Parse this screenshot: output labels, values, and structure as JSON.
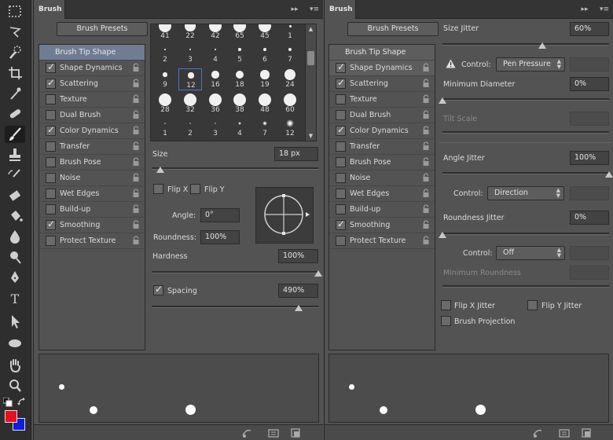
{
  "toolbar": {
    "tools": [
      {
        "name": "marquee-tool",
        "icon": "rect-marquee-icon",
        "active": false
      },
      {
        "name": "lasso-tool",
        "icon": "lasso-icon",
        "active": false
      },
      {
        "name": "quick-selection-tool",
        "icon": "quick-selection-icon",
        "active": false
      },
      {
        "name": "crop-tool",
        "icon": "crop-icon",
        "active": false
      },
      {
        "name": "eyedropper-tool",
        "icon": "eyedropper-icon",
        "active": false
      },
      {
        "name": "healing-tool",
        "icon": "bandage-icon",
        "active": false
      },
      {
        "name": "brush-tool",
        "icon": "brush-icon",
        "active": true
      },
      {
        "name": "stamp-tool",
        "icon": "stamp-icon",
        "active": false
      },
      {
        "name": "history-brush-tool",
        "icon": "history-brush-icon",
        "active": false
      },
      {
        "name": "eraser-tool",
        "icon": "eraser-icon",
        "active": false
      },
      {
        "name": "paint-bucket-tool",
        "icon": "bucket-icon",
        "active": false
      },
      {
        "name": "blur-tool",
        "icon": "drop-icon",
        "active": false
      },
      {
        "name": "dodge-tool",
        "icon": "dodge-icon",
        "active": false
      },
      {
        "name": "pen-tool",
        "icon": "pen-icon",
        "active": false
      },
      {
        "name": "type-tool",
        "icon": "type-icon",
        "glyph": "T",
        "active": false
      },
      {
        "name": "path-selection-tool",
        "icon": "arrow-icon",
        "active": false
      },
      {
        "name": "ellipse-tool",
        "icon": "ellipse-icon",
        "active": false
      },
      {
        "name": "hand-tool",
        "icon": "hand-icon",
        "active": false
      },
      {
        "name": "zoom-tool",
        "icon": "zoom-icon",
        "active": false
      }
    ],
    "foreground_color": "#e8101d",
    "background_color": "#0d1fd8"
  },
  "left_panel": {
    "tab": "Brush",
    "presets_button": "Brush Presets",
    "list": [
      {
        "label": "Brush Tip Shape",
        "header": true,
        "checked": false,
        "selected": true,
        "locked": false
      },
      {
        "label": "Shape Dynamics",
        "checked": true,
        "selected": false,
        "locked": true
      },
      {
        "label": "Scattering",
        "checked": true,
        "selected": false,
        "locked": true
      },
      {
        "label": "Texture",
        "checked": false,
        "selected": false,
        "locked": true
      },
      {
        "label": "Dual Brush",
        "checked": false,
        "selected": false,
        "locked": true
      },
      {
        "label": "Color Dynamics",
        "checked": true,
        "selected": false,
        "locked": true
      },
      {
        "label": "Transfer",
        "checked": false,
        "selected": false,
        "locked": true
      },
      {
        "label": "Brush Pose",
        "checked": false,
        "selected": false,
        "locked": true
      },
      {
        "label": "Noise",
        "checked": false,
        "selected": false,
        "locked": true
      },
      {
        "label": "Wet Edges",
        "checked": false,
        "selected": false,
        "locked": true
      },
      {
        "label": "Build-up",
        "checked": false,
        "selected": false,
        "locked": true
      },
      {
        "label": "Smoothing",
        "checked": true,
        "selected": false,
        "locked": true
      },
      {
        "label": "Protect Texture",
        "checked": false,
        "selected": false,
        "locked": true
      }
    ],
    "tips": [
      [
        "41",
        "22",
        "42",
        "65",
        "45",
        "1"
      ],
      [
        "2",
        "3",
        "4",
        "5",
        "6",
        "7"
      ],
      [
        "9",
        "12",
        "16",
        "18",
        "19",
        "24"
      ],
      [
        "28",
        "32",
        "36",
        "38",
        "48",
        "60"
      ],
      [
        "1",
        "2",
        "3",
        "4",
        "7",
        "12"
      ]
    ],
    "selected_tip": "12",
    "size_label": "Size",
    "size_value": "18 px",
    "size_slider": 0.05,
    "flip_x_label": "Flip X",
    "flip_y_label": "Flip Y",
    "flip_x": false,
    "flip_y": false,
    "angle_label": "Angle:",
    "angle_value": "0°",
    "roundness_label": "Roundness:",
    "roundness_value": "100%",
    "hardness_label": "Hardness",
    "hardness_value": "100%",
    "hardness_slider": 1.0,
    "spacing_label": "Spacing",
    "spacing_checked": true,
    "spacing_value": "490%",
    "spacing_slider": 0.88
  },
  "right_panel": {
    "tab": "Brush",
    "presets_button": "Brush Presets",
    "list": [
      {
        "label": "Brush Tip Shape",
        "header": true,
        "checked": false,
        "selected": false,
        "locked": false
      },
      {
        "label": "Shape Dynamics",
        "checked": true,
        "selected": true,
        "locked": true
      },
      {
        "label": "Scattering",
        "checked": true,
        "selected": false,
        "locked": true
      },
      {
        "label": "Texture",
        "checked": false,
        "selected": false,
        "locked": true
      },
      {
        "label": "Dual Brush",
        "checked": false,
        "selected": false,
        "locked": true
      },
      {
        "label": "Color Dynamics",
        "checked": true,
        "selected": false,
        "locked": true
      },
      {
        "label": "Transfer",
        "checked": false,
        "selected": false,
        "locked": true
      },
      {
        "label": "Brush Pose",
        "checked": false,
        "selected": false,
        "locked": true
      },
      {
        "label": "Noise",
        "checked": false,
        "selected": false,
        "locked": true
      },
      {
        "label": "Wet Edges",
        "checked": false,
        "selected": false,
        "locked": true
      },
      {
        "label": "Build-up",
        "checked": false,
        "selected": false,
        "locked": true
      },
      {
        "label": "Smoothing",
        "checked": true,
        "selected": false,
        "locked": true
      },
      {
        "label": "Protect Texture",
        "checked": false,
        "selected": false,
        "locked": true
      }
    ],
    "size_jitter_label": "Size Jitter",
    "size_jitter_value": "60%",
    "size_jitter_slider": 0.6,
    "control_label": "Control:",
    "size_control_value": "Pen Pressure",
    "min_diameter_label": "Minimum Diameter",
    "min_diameter_value": "0%",
    "min_diameter_slider": 0.0,
    "tilt_scale_label": "Tilt Scale",
    "angle_jitter_label": "Angle Jitter",
    "angle_jitter_value": "100%",
    "angle_jitter_slider": 1.0,
    "angle_control_value": "Direction",
    "roundness_jitter_label": "Roundness Jitter",
    "roundness_jitter_value": "0%",
    "roundness_jitter_slider": 0.0,
    "roundness_control_value": "Off",
    "min_roundness_label": "Minimum Roundness",
    "flip_x_jitter_label": "Flip X Jitter",
    "flip_y_jitter_label": "Flip Y Jitter",
    "brush_projection_label": "Brush Projection",
    "flip_x_jitter": false,
    "flip_y_jitter": false,
    "brush_projection": false
  }
}
